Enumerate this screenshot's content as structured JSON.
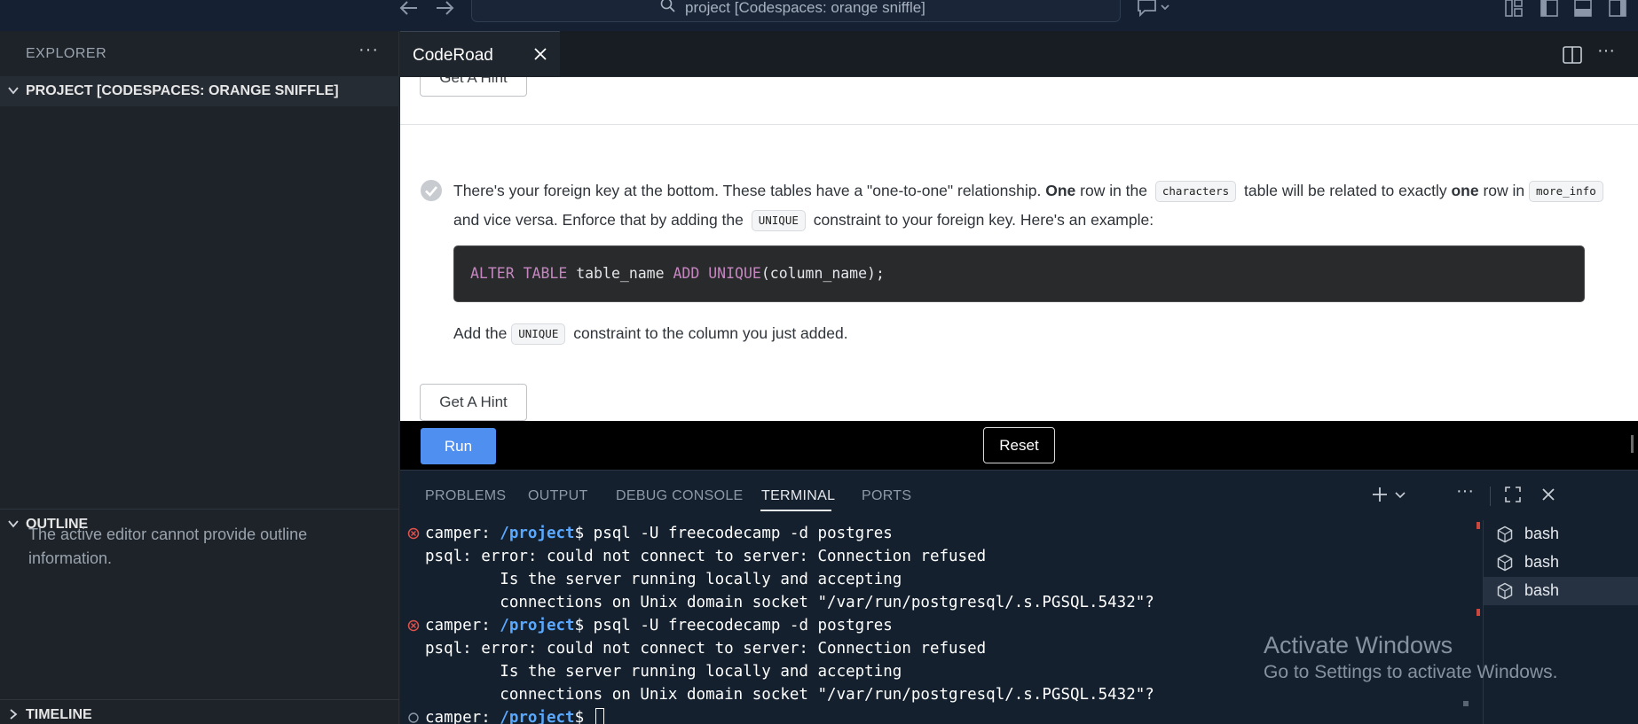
{
  "titlebar": {
    "command_center": "project [Codespaces: orange sniffle]"
  },
  "sidebar": {
    "title": "EXPLORER",
    "more": "···",
    "project_section": "PROJECT [CODESPACES: ORANGE SNIFFLE]",
    "outline_section": "OUTLINE",
    "outline_message": "The active editor cannot provide outline information.",
    "timeline_section": "TIMELINE"
  },
  "editor": {
    "tab_label": "CodeRoad",
    "more": "···"
  },
  "coderoad": {
    "hint_label": "Get A Hint",
    "step": {
      "t1": "There's your foreign key at the bottom. These tables have a \"one-to-one\" relationship. ",
      "b1": "One",
      "t2": " row in the ",
      "c1": "characters",
      "t3": " table will be related to exactly ",
      "b2": "one",
      "t4": " row in ",
      "c2": "more_info",
      "t5": " and vice versa. Enforce that by adding the ",
      "c3": "UNIQUE",
      "t6": " constraint to your foreign key. Here's an example:"
    },
    "code": {
      "k1": "ALTER TABLE",
      "p1": " table_name ",
      "k2": "ADD UNIQUE",
      "p2": "(column_name);"
    },
    "step2": {
      "t1": "Add the ",
      "c1": "UNIQUE",
      "t2": " constraint to the column you just added."
    },
    "run_label": "Run",
    "reset_label": "Reset"
  },
  "panel": {
    "tabs": [
      "PROBLEMS",
      "OUTPUT",
      "DEBUG CONSOLE",
      "TERMINAL",
      "PORTS"
    ],
    "active_tab": "TERMINAL",
    "more": "···"
  },
  "terminal": {
    "prompt_user": "camper: ",
    "prompt_path": "/project",
    "prompt_sign": "$ ",
    "command": "psql -U freecodecamp -d postgres",
    "error1": "psql: error: could not connect to server: Connection refused",
    "error2": "        Is the server running locally and accepting",
    "error3": "        connections on Unix domain socket \"/var/run/postgresql/.s.PGSQL.5432\"?",
    "sessions": [
      "bash",
      "bash",
      "bash"
    ],
    "selected_session": 2
  },
  "watermark": {
    "line1": "Activate Windows",
    "line2": "Go to Settings to activate Windows."
  },
  "colors": {
    "accent_run": "#4e8ff0",
    "path": "#5aa9ff",
    "keyword": "#c586c0",
    "error_marker": "#e0524b"
  }
}
